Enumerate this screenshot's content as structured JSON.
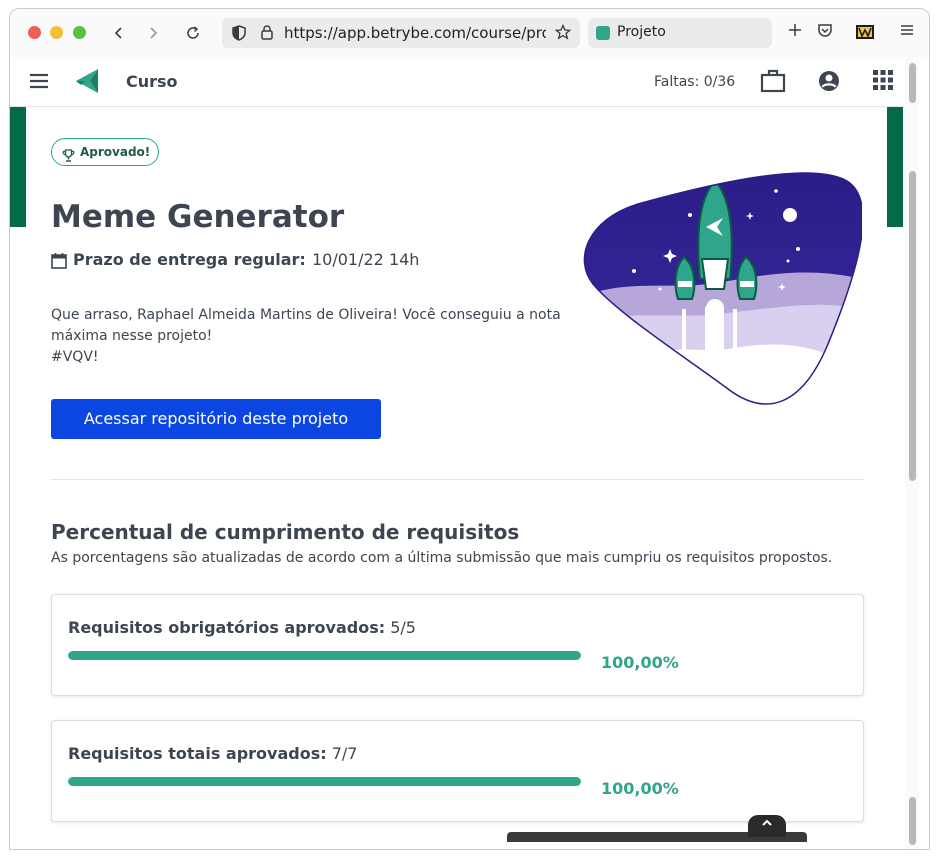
{
  "browser": {
    "url": "https://app.betrybe.com/course/proje",
    "tab_title": "Projeto"
  },
  "header": {
    "course_label": "Curso",
    "absences_label": "Faltas: 0/36"
  },
  "project": {
    "badge": "Aprovado!",
    "title": "Meme Generator",
    "deadline_label": "Prazo de entrega regular:",
    "deadline_value": "10/01/22 14h",
    "message_line1": "Que arraso, Raphael Almeida Martins de Oliveira! Você conseguiu a nota máxima nesse projeto!",
    "message_line2": "#VQV!",
    "repo_button": "Acessar repositório deste projeto"
  },
  "requirements": {
    "title": "Percentual de cumprimento de requisitos",
    "subtitle": "As porcentagens são atualizadas de acordo com a última submissão que mais cumpriu os requisitos propostos.",
    "cards": [
      {
        "label": "Requisitos obrigatórios aprovados:",
        "value": "5/5",
        "percent_text": "100,00%",
        "percent": 100
      },
      {
        "label": "Requisitos totais aprovados:",
        "value": "7/7",
        "percent_text": "100,00%",
        "percent": 100
      }
    ]
  },
  "colors": {
    "accent_green": "#2fa58c",
    "brand_green": "#036b47",
    "button_blue": "#0b46e3"
  }
}
